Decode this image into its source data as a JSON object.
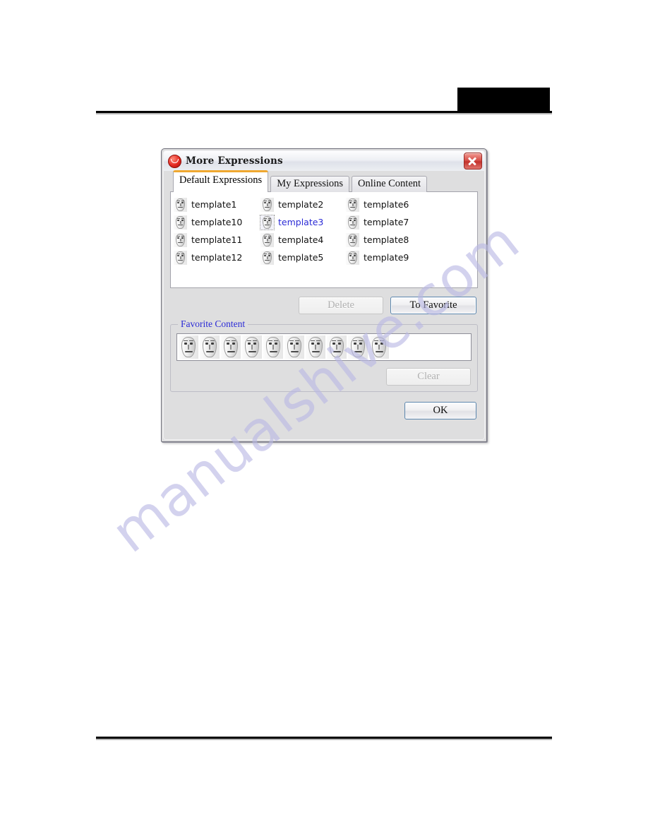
{
  "page": {
    "redaction_label": "redacted-header-block"
  },
  "watermark": {
    "text": "manualshive.com"
  },
  "dialog": {
    "title": "More Expressions",
    "title_icon": "smiley-face-icon",
    "close_icon": "close-icon",
    "tabs": [
      {
        "label": "Default Expressions",
        "active": true
      },
      {
        "label": "My Expressions",
        "active": false
      },
      {
        "label": "Online Content",
        "active": false
      }
    ],
    "templates": {
      "column1": [
        "template1",
        "template10",
        "template11",
        "template12"
      ],
      "column2": [
        "template2",
        "template3",
        "template4",
        "template5"
      ],
      "column3": [
        "template6",
        "template7",
        "template8",
        "template9"
      ],
      "selected": "template3"
    },
    "buttons": {
      "delete": "Delete",
      "delete_enabled": false,
      "to_favorite": "To Favorite",
      "to_favorite_enabled": true,
      "clear": "Clear",
      "clear_enabled": false,
      "ok": "OK",
      "ok_enabled": true
    },
    "favorite_group": {
      "title": "Favorite Content",
      "item_count": 10
    }
  },
  "colors": {
    "dialog_face": "#dededf",
    "active_tab_accent": "#f0a830",
    "selected_text": "#2b2bd6",
    "group_title": "#2b2bd6",
    "close_button": "#c3322b",
    "watermark": "#b9b8e4"
  }
}
